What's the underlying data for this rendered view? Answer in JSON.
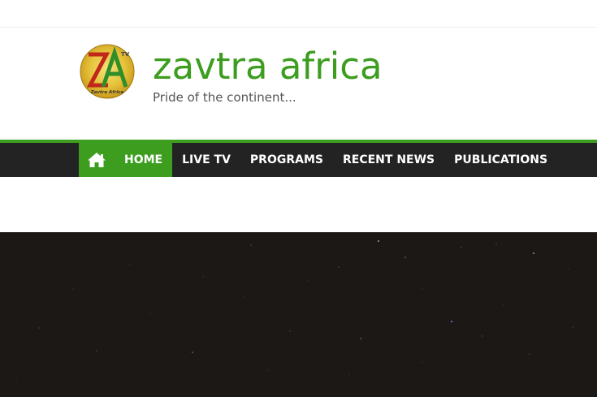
{
  "site": {
    "title": "zavtra africa",
    "tagline": "Pride of the continent...",
    "logo_letters": "ZA",
    "logo_superscript": "TV",
    "logo_caption": "Zavtra Africa"
  },
  "nav": {
    "home_icon": "home-icon",
    "items": [
      {
        "label": "HOME",
        "active": true
      },
      {
        "label": "LIVE TV",
        "active": false
      },
      {
        "label": "PROGRAMS",
        "active": false
      },
      {
        "label": "RECENT NEWS",
        "active": false
      },
      {
        "label": "PUBLICATIONS",
        "active": false
      }
    ]
  },
  "colors": {
    "accent": "#3c9d1f",
    "nav_bg": "#232323",
    "hero_bg": "#1c1816"
  },
  "hero": {
    "background": "starry-night-sky"
  }
}
